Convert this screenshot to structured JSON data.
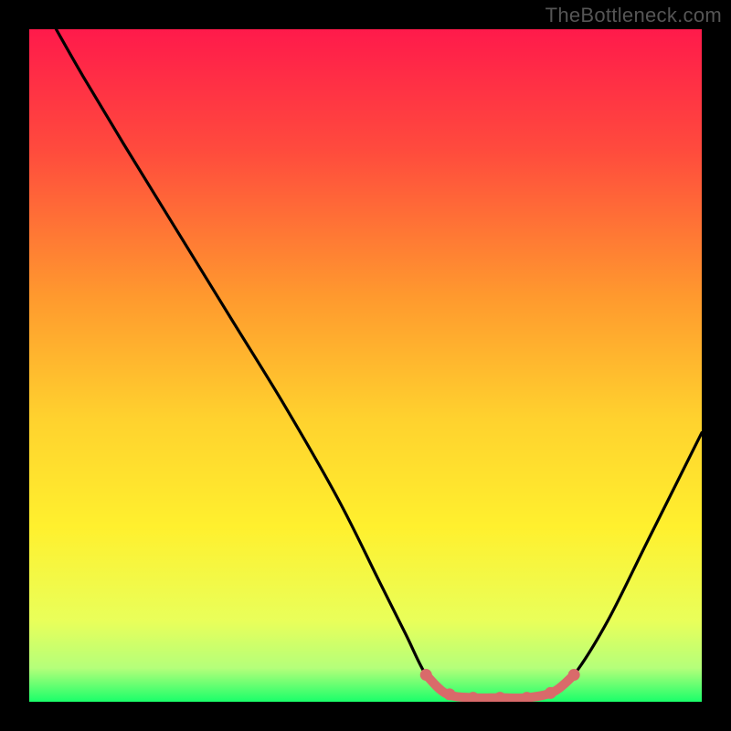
{
  "watermark": "TheBottleneck.com",
  "chart_data": {
    "type": "line",
    "title": "",
    "xlabel": "",
    "ylabel": "",
    "xlim": [
      0,
      100
    ],
    "ylim": [
      0,
      100
    ],
    "gradient_stops": [
      {
        "offset": 0,
        "color": "#ff1a4b"
      },
      {
        "offset": 0.18,
        "color": "#ff4b3d"
      },
      {
        "offset": 0.4,
        "color": "#ff9a2e"
      },
      {
        "offset": 0.58,
        "color": "#ffd22e"
      },
      {
        "offset": 0.74,
        "color": "#fff02e"
      },
      {
        "offset": 0.88,
        "color": "#e9ff5a"
      },
      {
        "offset": 0.95,
        "color": "#b4ff7a"
      },
      {
        "offset": 1.0,
        "color": "#1aff6a"
      }
    ],
    "series": [
      {
        "name": "bottleneck-curve",
        "color": "#000000",
        "points": [
          {
            "x": 4,
            "y": 100
          },
          {
            "x": 8,
            "y": 93
          },
          {
            "x": 14,
            "y": 83
          },
          {
            "x": 22,
            "y": 70
          },
          {
            "x": 30,
            "y": 57
          },
          {
            "x": 38,
            "y": 44
          },
          {
            "x": 46,
            "y": 30
          },
          {
            "x": 52,
            "y": 18
          },
          {
            "x": 56,
            "y": 10
          },
          {
            "x": 59,
            "y": 4
          },
          {
            "x": 62,
            "y": 1.2
          },
          {
            "x": 66,
            "y": 0.6
          },
          {
            "x": 70,
            "y": 0.6
          },
          {
            "x": 74,
            "y": 0.6
          },
          {
            "x": 78,
            "y": 1.5
          },
          {
            "x": 81,
            "y": 4
          },
          {
            "x": 86,
            "y": 12
          },
          {
            "x": 92,
            "y": 24
          },
          {
            "x": 100,
            "y": 40
          }
        ]
      }
    ],
    "highlight_segment": {
      "color": "#d96a6a",
      "points": [
        {
          "x": 59,
          "y": 4
        },
        {
          "x": 62,
          "y": 1.2
        },
        {
          "x": 66,
          "y": 0.6
        },
        {
          "x": 70,
          "y": 0.6
        },
        {
          "x": 74,
          "y": 0.6
        },
        {
          "x": 78,
          "y": 1.5
        },
        {
          "x": 81,
          "y": 4
        }
      ],
      "dots": [
        {
          "x": 59,
          "y": 4
        },
        {
          "x": 62.5,
          "y": 1.1
        },
        {
          "x": 66,
          "y": 0.6
        },
        {
          "x": 70,
          "y": 0.6
        },
        {
          "x": 74,
          "y": 0.6
        },
        {
          "x": 77.5,
          "y": 1.3
        },
        {
          "x": 81,
          "y": 4
        }
      ]
    }
  }
}
